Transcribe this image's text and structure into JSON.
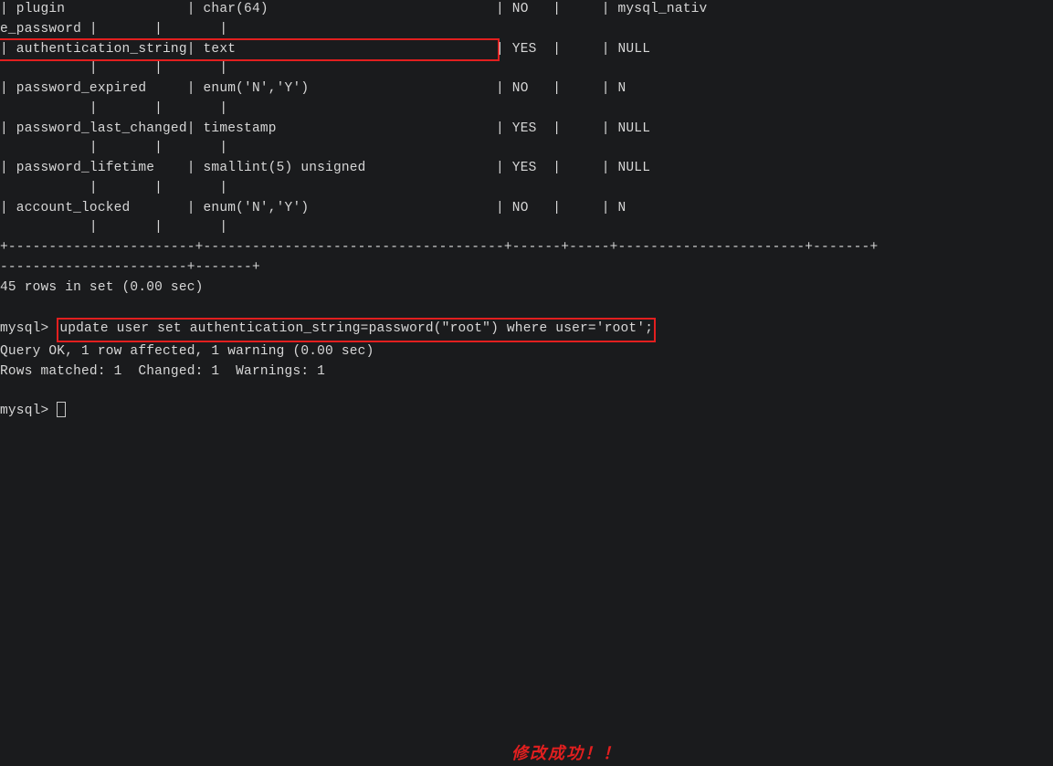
{
  "table": {
    "rows": [
      {
        "field": "plugin",
        "type": "char(64)",
        "nullv": "NO",
        "default": "mysql_nativ",
        "wrap": "e_password |       |       |"
      },
      {
        "field": "authentication_string",
        "type": "text",
        "nullv": "YES",
        "default": "NULL",
        "wrap": "           |       |       |",
        "highlight": true
      },
      {
        "field": "password_expired",
        "type": "enum('N','Y')",
        "nullv": "NO",
        "default": "N",
        "wrap": "           |       |       |"
      },
      {
        "field": "password_last_changed",
        "type": "timestamp",
        "nullv": "YES",
        "default": "NULL",
        "wrap": "           |       |       |"
      },
      {
        "field": "password_lifetime",
        "type": "smallint(5) unsigned",
        "nullv": "YES",
        "default": "NULL",
        "wrap": "           |       |       |"
      },
      {
        "field": "account_locked",
        "type": "enum('N','Y')",
        "nullv": "NO",
        "default": "N",
        "wrap": "           |       |       |"
      }
    ],
    "divider": "+-----------------------+-------------------------------------+------+-----+-----------------------+-------+",
    "summary": "45 rows in set (0.00 sec)"
  },
  "command": {
    "prompt": "mysql> ",
    "sql": "update user set authentication_string=password(\"root\") where user='root';"
  },
  "result": {
    "line1": "Query OK, 1 row affected, 1 warning (0.00 sec)",
    "line2": "Rows matched: 1  Changed: 1  Warnings: 1"
  },
  "annotation": "修改成功！！",
  "idle_prompt": "mysql> "
}
